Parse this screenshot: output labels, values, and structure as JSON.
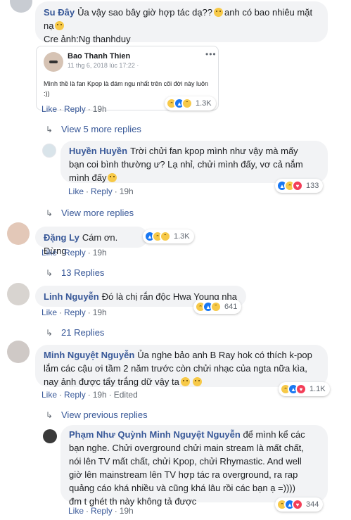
{
  "comments": [
    {
      "id": "su-day",
      "author": "Su Đây",
      "text": "Ủa vậy sao bây giờ hợp tác dạ??",
      "text2": "anh có bao nhiêu mặt",
      "text3": "nạ",
      "text4": "Cre ảnh:Ng thanhduy",
      "actions": {
        "like": "Like",
        "reply": "Reply",
        "time": "19h"
      },
      "reactions": {
        "count": "1.3K"
      },
      "shared_post": {
        "author": "Bao Thanh Thien",
        "timestamp": "11 thg 6, 2018 lúc 17:22 · ",
        "text": "Mình thề là fan Kpop là đám ngu nhất trên cõi đời này luôn :))",
        "dots": "•••"
      }
    }
  ],
  "view_more_5": "View 5 more replies",
  "reply_huyen": {
    "author": "Huyền Huyền",
    "line1": "Trời chửi fan kpop mình như vậy mà mấy",
    "line2": "bạn coi bình thường ư? Lạ nhỉ, chửi mình đấy, vơ cả nắm",
    "line3": "mình đấy",
    "actions": {
      "like": "Like",
      "reply": "Reply",
      "time": "19h"
    },
    "reactions": {
      "count": "133"
    }
  },
  "view_more_replies": "View more replies",
  "comment_dang": {
    "author": "Đặng Ly",
    "text": "Cám ơn. Đừng",
    "actions": {
      "like": "Like",
      "reply": "Reply",
      "time": "19h"
    },
    "reactions": {
      "count": "1.3K"
    },
    "replies": "13 Replies"
  },
  "comment_linh": {
    "author": "Linh Nguyễn",
    "text": "Đó là chị rắn độc Hwa Young nha",
    "actions": {
      "like": "Like",
      "reply": "Reply",
      "time": "19h"
    },
    "reactions": {
      "count": "641"
    },
    "replies": "21 Replies"
  },
  "comment_minh": {
    "author": "Minh Nguyệt Nguyễn",
    "line1": "Ủa nghe bảo anh B Ray hok có thích k-pop",
    "line2": "lắm các cậu ơi tầm 2 năm trước còn chửi nhạc của ngta nữa kìa,",
    "line3": "nay ảnh được tẩy trắng dữ vậy ta",
    "actions": {
      "like": "Like",
      "reply": "Reply",
      "time": "19h",
      "edited": "Edited"
    },
    "reactions": {
      "count": "1.1K"
    }
  },
  "view_previous": "View previous replies",
  "reply_pham": {
    "author": "Phạm Như Quỳnh",
    "mention": "Minh Nguyệt Nguyễn",
    "line1": "để mình kể các",
    "line2": "bạn nghe. Chửi overground chửi main stream là mất chất,",
    "line3": "nói lên TV mất chất, chửi Kpop, chửi Rhymastic. And well",
    "line4": "giờ lên mainstream lên TV hợp tác ra overground, ra rap",
    "line5": "quảng cáo khá nhiều và cũng khá lâu rồi các bạn ạ =))))",
    "line6": "đm t ghét th này không tả được",
    "actions": {
      "like": "Like",
      "reply": "Reply",
      "time": "19h"
    },
    "reactions": {
      "count": "344"
    }
  },
  "colors": {
    "link": "#385898",
    "bubble": "#f2f3f5",
    "meta": "#606770",
    "like_blue": "#1877f2",
    "love_red": "#f33e58",
    "haha_yellow": "#f7c948"
  }
}
